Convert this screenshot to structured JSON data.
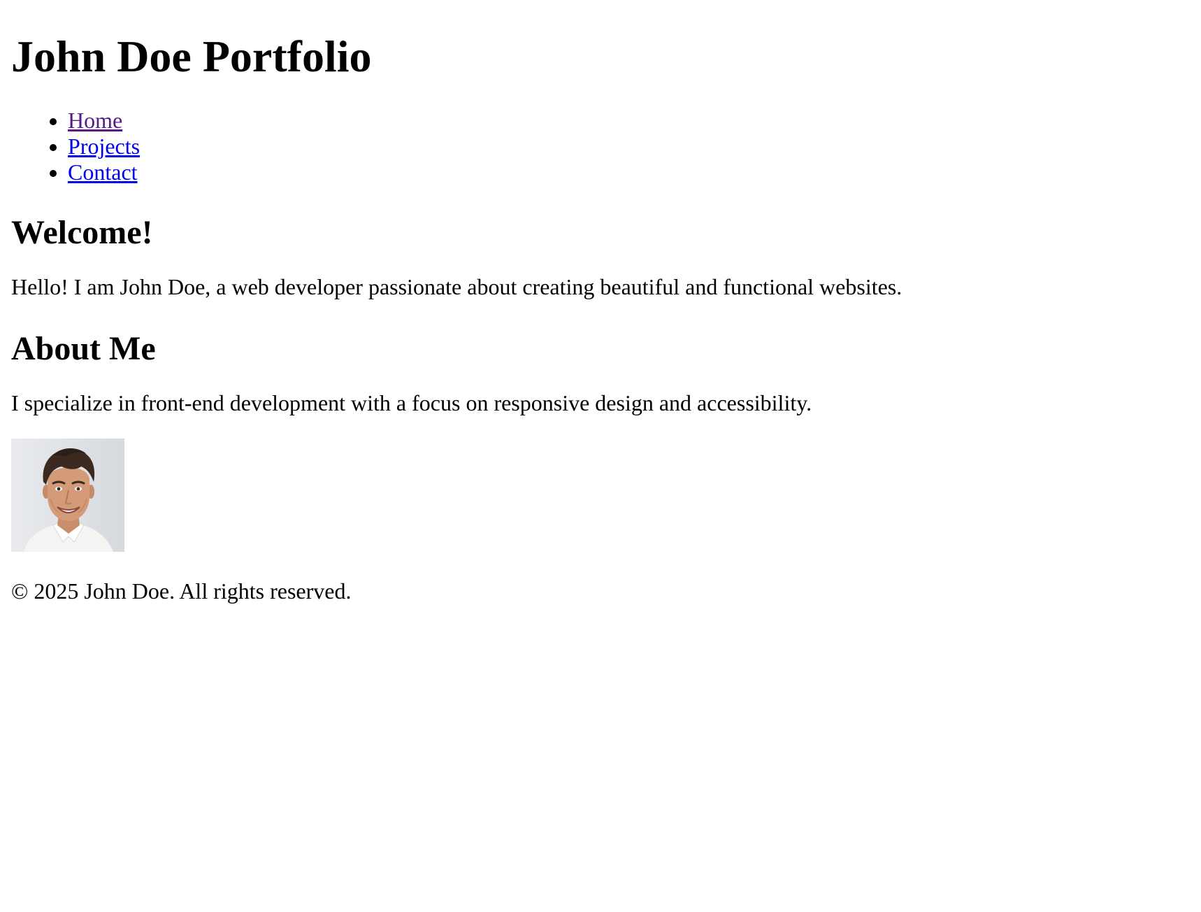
{
  "header": {
    "title": "John Doe Portfolio"
  },
  "nav": {
    "items": [
      {
        "label": "Home"
      },
      {
        "label": "Projects"
      },
      {
        "label": "Contact"
      }
    ]
  },
  "welcome": {
    "heading": "Welcome!",
    "text": "Hello! I am John Doe, a web developer passionate about creating beautiful and functional websites."
  },
  "about": {
    "heading": "About Me",
    "text": "I specialize in front-end development with a focus on responsive design and accessibility."
  },
  "footer": {
    "text": "© 2025 John Doe. All rights reserved."
  },
  "colors": {
    "link": "#0000ee",
    "link_visited": "#551a8b",
    "text": "#000000",
    "background": "#ffffff"
  }
}
